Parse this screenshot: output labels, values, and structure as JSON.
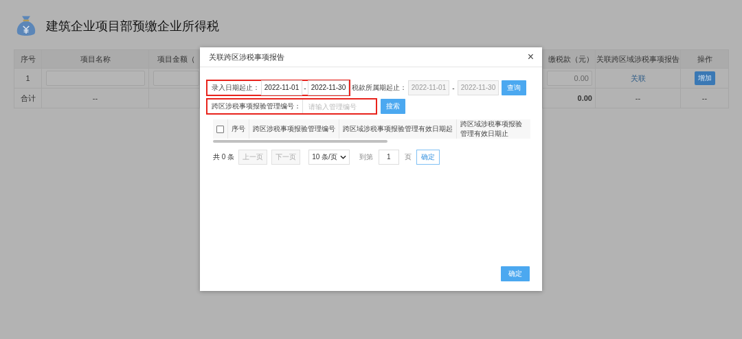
{
  "page": {
    "title": "建筑企业项目部预缴企业所得税"
  },
  "table": {
    "columns": [
      "序号",
      "项目名称",
      "项目金额（",
      "缴税款（元）",
      "关联跨区域涉税事项报告",
      "操作"
    ],
    "rows": [
      {
        "kind": "entry",
        "index": "1",
        "amount": "0.00",
        "link": "关联",
        "action": "增加"
      },
      {
        "kind": "total",
        "index": "合计",
        "name": "--",
        "amount": "0.00",
        "link": "--",
        "action": "--"
      }
    ]
  },
  "dialog": {
    "title": "关联跨区涉税事项报告",
    "close": "×",
    "entry_date": {
      "label": "录入日期起止：",
      "from": "2022-11-01",
      "to": "2022-11-30",
      "separator": "-",
      "highlighted": true
    },
    "tax_period": {
      "label": "税款所属期起止：",
      "from": "2022-11-01",
      "to": "2022-11-30",
      "separator": "-",
      "disabled": true
    },
    "query_button": "查询",
    "code_filter": {
      "label": "跨区涉税事项报验管理编号：",
      "placeholder": "请输入管理编号",
      "highlighted": true
    },
    "search_button": "搜索",
    "list": {
      "checked": false,
      "columns": [
        "序号",
        "跨区涉税事项报验管理编号",
        "跨区域涉税事项报验管理有效日期起",
        "跨区域涉税事项报验管理有效日期止"
      ]
    },
    "pager": {
      "total": "共 0 条",
      "prev": {
        "label": "上一页",
        "disabled": true
      },
      "next": {
        "label": "下一页",
        "disabled": true
      },
      "page_size": "10 条/页",
      "goto_label": "到第",
      "page": "1",
      "page_unit": "页",
      "go_button": "确定"
    },
    "confirm_button": "确定"
  }
}
